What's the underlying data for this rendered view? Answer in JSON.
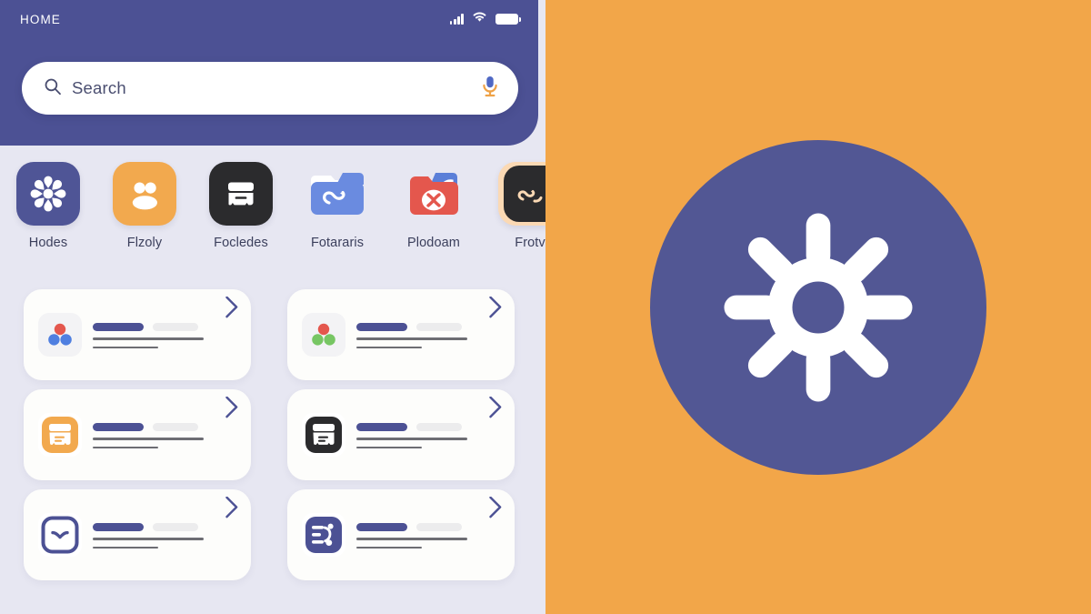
{
  "colors": {
    "header_indigo": "#4c5194",
    "page_bg": "#e7e7f2",
    "card_bg": "#fdfdfb",
    "accent_orange": "#f2a649",
    "panel_disc": "#525794",
    "bar_dark": "#4c5194",
    "bar_ghost": "#ececed",
    "text_dark": "#3b3f5c"
  },
  "phone": {
    "statusbar": {
      "title": "HOME",
      "icons": [
        "signal-icon",
        "wifi-icon",
        "battery-icon"
      ]
    },
    "search": {
      "placeholder": "Search",
      "search_icon": "search-icon",
      "mic_icon": "microphone-icon"
    },
    "apps": [
      {
        "label": "Hodes",
        "icon": "flower-asterisk-icon",
        "tile_color": "#4f5596",
        "glyph_color": "#ffffff"
      },
      {
        "label": "Flzoly",
        "icon": "people-group-icon",
        "tile_color": "#f2a94e",
        "glyph_color": "#ffffff"
      },
      {
        "label": "Focledes",
        "icon": "archive-box-icon",
        "tile_color": "#2b2b2d",
        "glyph_color": "#ffffff"
      },
      {
        "label": "Fotararis",
        "icon": "folder-swirl-icon",
        "tile_color": "#6a8be0",
        "glyph_color": "#ffffff"
      },
      {
        "label": "Plodoam",
        "icon": "folder-x-badge-icon",
        "tile_color": "#e4574d",
        "glyph_color": "#ffffff"
      },
      {
        "label": "Frotv",
        "icon": "swirl-icon",
        "tile_color": "#fbd9b4",
        "glyph_color": "#2b2b2d"
      }
    ],
    "cards": [
      {
        "icon": "three-circles-red-blue-icon",
        "icon_bg": "#f3f3f5",
        "arrow": "arrow-up-right-icon"
      },
      {
        "icon": "three-circles-red-green-icon",
        "icon_bg": "#f3f3f5",
        "arrow": "arrow-up-right-icon"
      },
      {
        "icon": "orange-archive-icon",
        "icon_bg": "#ffffff",
        "arrow": "arrow-up-right-icon"
      },
      {
        "icon": "dark-archive-icon",
        "icon_bg": "#ffffff",
        "arrow": "arrow-up-right-icon"
      },
      {
        "icon": "chevron-down-box-icon",
        "icon_bg": "#ffffff",
        "arrow": "arrow-up-right-icon"
      },
      {
        "icon": "list-branch-icon",
        "icon_bg": "#4c5194",
        "arrow": "arrow-up-right-icon"
      }
    ]
  },
  "panel": {
    "background_color": "#f2a649",
    "disc_color": "#525794",
    "icon": "gear-settings-icon",
    "icon_color": "#ffffff",
    "gear_teeth": 8
  }
}
